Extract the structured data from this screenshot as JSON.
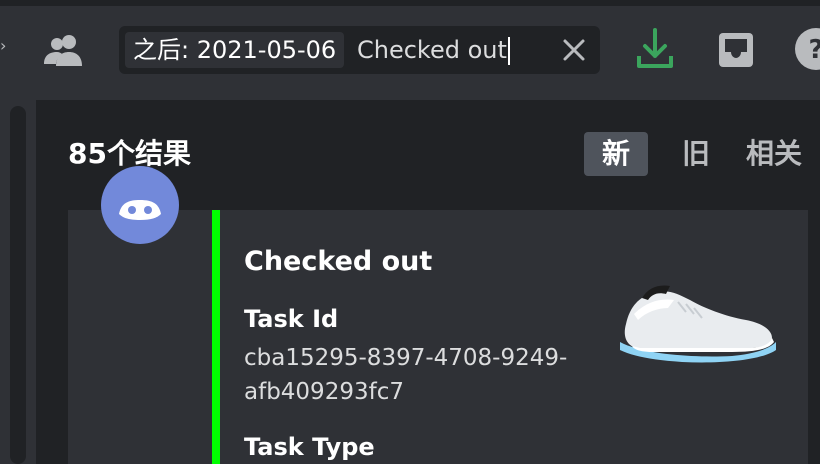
{
  "search": {
    "filter_chip": "之后: 2021-05-06",
    "query": "Checked out"
  },
  "results": {
    "count_label": "85个结果",
    "sort_tabs": [
      {
        "label": "新",
        "active": true
      },
      {
        "label": "旧",
        "active": false
      },
      {
        "label": "相关",
        "active": false
      }
    ]
  },
  "embed": {
    "accent_color": "#00ff00",
    "title": "Checked out",
    "fields": [
      {
        "name": "Task Id",
        "value": "cba15295-8397-4708-9249-afb409293fc7"
      },
      {
        "name": "Task Type",
        "value": ""
      }
    ]
  },
  "icons": {
    "members": "members-icon",
    "clear": "close-icon",
    "download": "download-icon",
    "inbox": "inbox-icon",
    "help": "help-icon",
    "bot_avatar": "discord-logo-icon",
    "product_thumbnail": "sneaker-image"
  },
  "colors": {
    "download_icon": "#3ba55d",
    "avatar_bg": "#7289da",
    "active_tab_bg": "#4f545c"
  }
}
